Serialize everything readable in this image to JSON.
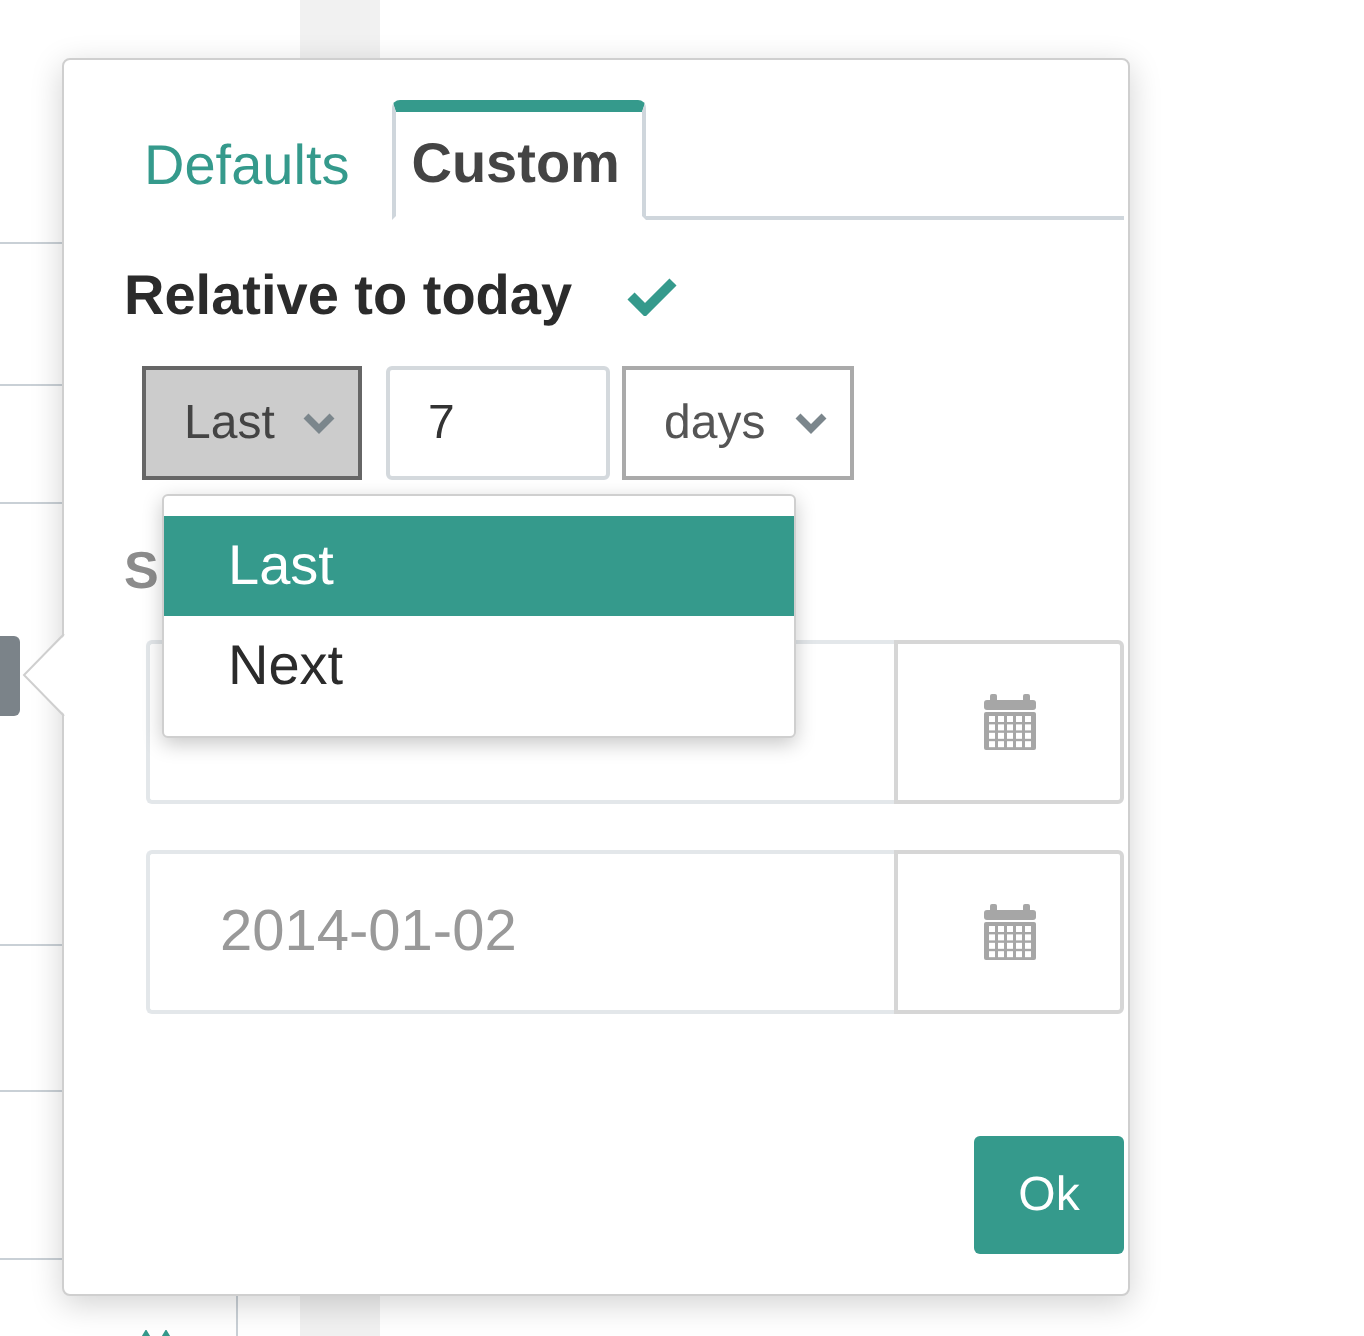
{
  "tabs": [
    {
      "label": "Defaults",
      "selected": false
    },
    {
      "label": "Custom",
      "selected": true
    }
  ],
  "relative": {
    "label": "Relative to today",
    "checked": true,
    "direction": {
      "value": "Last",
      "expanded": true,
      "options": [
        {
          "label": "Last",
          "selected": true
        },
        {
          "label": "Next",
          "selected": false
        }
      ]
    },
    "amount": {
      "value": "7"
    },
    "unit": {
      "value": "days",
      "expanded": false
    }
  },
  "specific": {
    "heading": "S",
    "disabled": true,
    "end_date": {
      "placeholder": "2014-01-02"
    }
  },
  "ok_button": "Ok"
}
